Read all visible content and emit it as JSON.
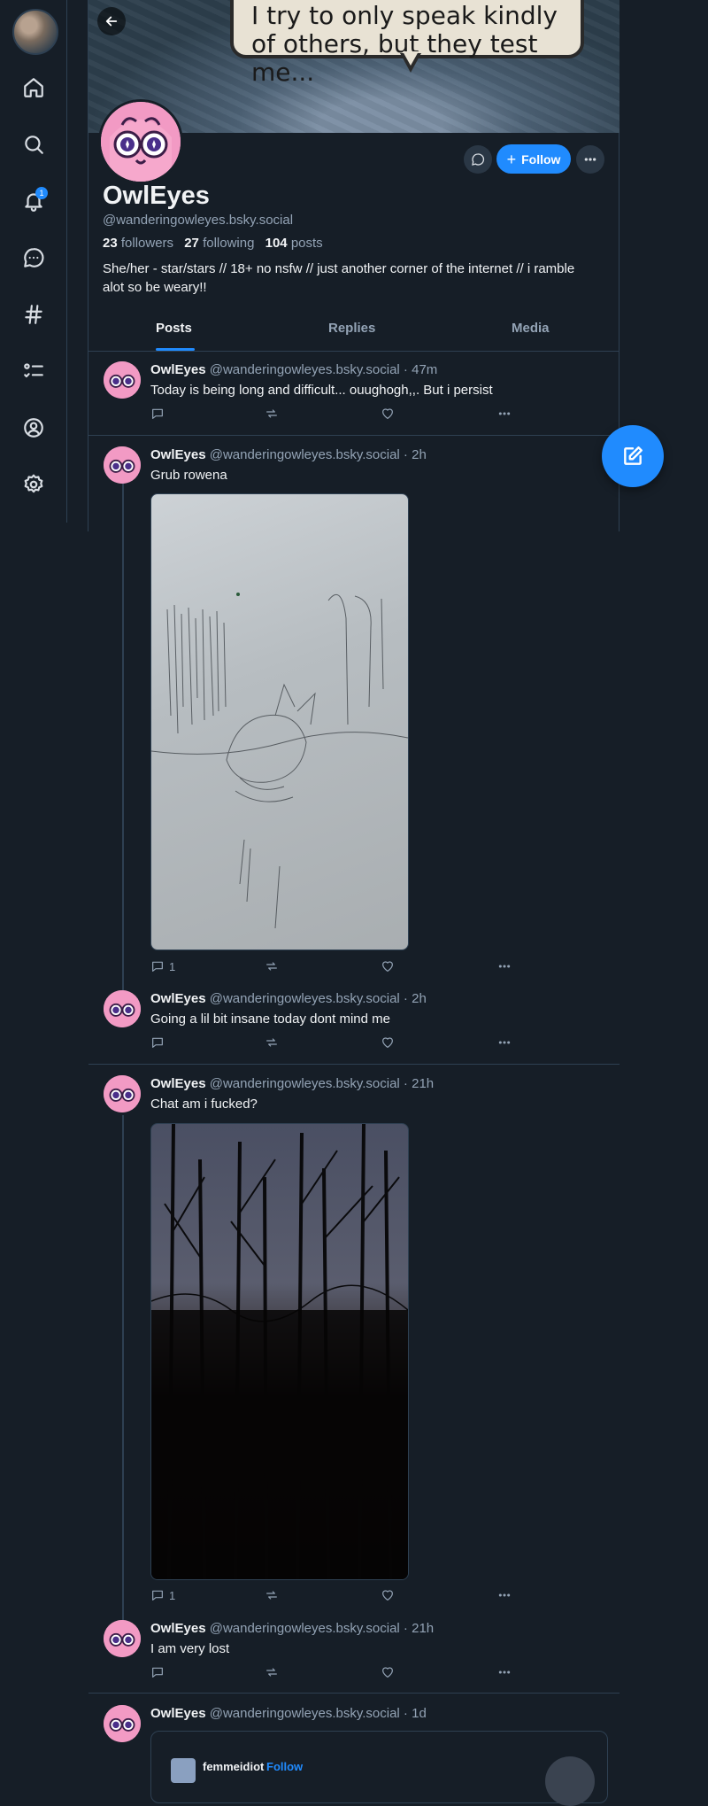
{
  "nav": {
    "notification_count": "1",
    "items": [
      "home",
      "search",
      "notifications",
      "chat",
      "feeds",
      "lists",
      "profile",
      "settings"
    ]
  },
  "banner": {
    "speech_text": "I try to only speak kindly of others, but they test me..."
  },
  "profile": {
    "display_name": "OwlEyes",
    "handle": "@wanderingowleyes.bsky.social",
    "followers_count": "23",
    "followers_label": "followers",
    "following_count": "27",
    "following_label": "following",
    "posts_count": "104",
    "posts_label": "posts",
    "bio": "She/her - star/stars // 18+ no nsfw // just another corner of the internet // i ramble alot so be weary!!",
    "follow_label": "Follow"
  },
  "tabs": [
    "Posts",
    "Replies",
    "Media"
  ],
  "posts": [
    {
      "name": "OwlEyes",
      "meta": "@wanderingowleyes.bsky.social · 47m",
      "text": "Today is being long and difficult... ouughogh,,. But i persist",
      "replies": ""
    },
    {
      "name": "OwlEyes",
      "meta": "@wanderingowleyes.bsky.social · 2h",
      "text": "Grub rowena",
      "replies": "1"
    },
    {
      "name": "OwlEyes",
      "meta": "@wanderingowleyes.bsky.social · 2h",
      "text": "Going a lil bit insane today dont mind me",
      "replies": ""
    },
    {
      "name": "OwlEyes",
      "meta": "@wanderingowleyes.bsky.social · 21h",
      "text": "Chat am i fucked?",
      "replies": "1"
    },
    {
      "name": "OwlEyes",
      "meta": "@wanderingowleyes.bsky.social · 21h",
      "text": "I am very lost",
      "replies": ""
    },
    {
      "name": "OwlEyes",
      "meta": "@wanderingowleyes.bsky.social · 1d",
      "text": "",
      "replies": ""
    }
  ],
  "quote": {
    "name": "femmeidiot",
    "follow_label": "Follow"
  },
  "colors": {
    "background": "#161e27",
    "accent": "#208bfe",
    "muted_text": "#93a3b5",
    "border": "#2e4052"
  }
}
